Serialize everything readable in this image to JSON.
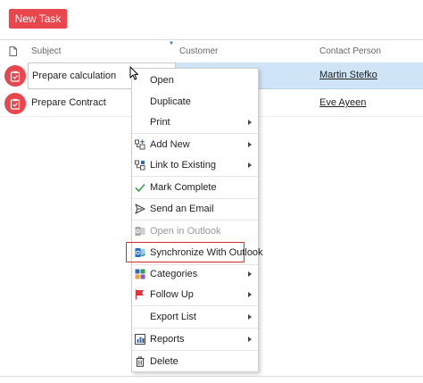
{
  "toolbar": {
    "new_task_label": "New Task"
  },
  "columns": {
    "subject": "Subject",
    "customer": "Customer",
    "contact": "Contact Person"
  },
  "rows": [
    {
      "subject": "Prepare calculation",
      "customer": "",
      "contact": "Martin Stefko",
      "selected": true
    },
    {
      "subject": "Prepare Contract",
      "customer": "",
      "contact": "Eve Ayeen",
      "selected": false
    }
  ],
  "context_menu": {
    "items": [
      {
        "label": "Open",
        "icon": "none",
        "submenu": false,
        "disabled": false
      },
      {
        "label": "Duplicate",
        "icon": "none",
        "submenu": false,
        "disabled": false
      },
      {
        "label": "Print",
        "icon": "none",
        "submenu": true,
        "disabled": false
      },
      {
        "label": "Add New",
        "icon": "add-new-icon",
        "submenu": true,
        "disabled": false
      },
      {
        "label": "Link to Existing",
        "icon": "link-icon",
        "submenu": true,
        "disabled": false
      },
      {
        "label": "Mark Complete",
        "icon": "checkmark-icon",
        "submenu": false,
        "disabled": false
      },
      {
        "label": "Send an Email",
        "icon": "send-icon",
        "submenu": false,
        "disabled": false
      },
      {
        "label": "Open in Outlook",
        "icon": "outlook-icon",
        "submenu": false,
        "disabled": true
      },
      {
        "label": "Synchronize With Outlook",
        "icon": "sync-outlook-icon",
        "submenu": false,
        "disabled": false,
        "highlighted": true
      },
      {
        "label": "Categories",
        "icon": "categories-icon",
        "submenu": true,
        "disabled": false
      },
      {
        "label": "Follow Up",
        "icon": "flag-icon",
        "submenu": true,
        "disabled": false
      },
      {
        "label": "Export List",
        "icon": "none",
        "submenu": true,
        "disabled": false
      },
      {
        "label": "Reports",
        "icon": "reports-icon",
        "submenu": true,
        "disabled": false
      },
      {
        "label": "Delete",
        "icon": "trash-icon",
        "submenu": false,
        "disabled": false
      }
    ]
  },
  "colors": {
    "accent_red": "#e8474d",
    "selection_blue": "#cfe4f7",
    "highlight_border": "#d6282f",
    "check_green": "#3a9d4a",
    "flag_red": "#e0343a",
    "outlook_blue": "#1f6fc4"
  }
}
